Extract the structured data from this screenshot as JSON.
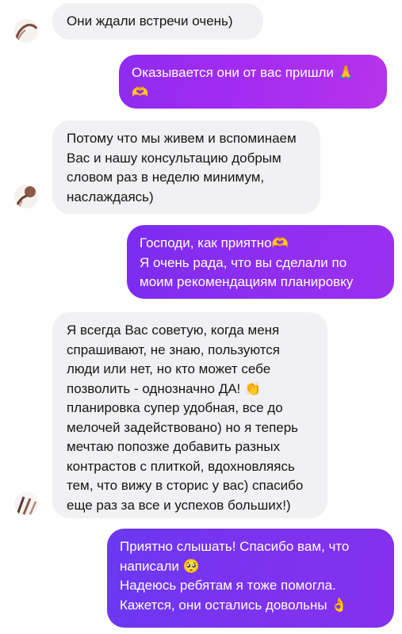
{
  "messages": [
    {
      "direction": "incoming",
      "lines": [
        "Они ждали встречи очень)"
      ]
    },
    {
      "direction": "outgoing",
      "lines": [
        "Оказывается они от вас пришли 🙏",
        "🫶"
      ]
    },
    {
      "direction": "incoming",
      "lines": [
        "Потому что мы живем и вспоминаем",
        "Вас и нашу консультацию добрым",
        "словом раз в неделю минимум,",
        "наслаждаясь)"
      ]
    },
    {
      "direction": "outgoing",
      "lines": [
        "Господи, как приятно🫶",
        "Я очень рада, что вы сделали по",
        "моим рекомендациям планировку"
      ]
    },
    {
      "direction": "incoming",
      "lines": [
        "Я всегда Вас советую, когда меня",
        "спрашивают, не знаю, пользуются",
        "люди или нет, но кто может себе",
        "позволить - однозначно ДА! 👏",
        "планировка супер удобная, все до",
        "мелочей задействовано) но я теперь",
        "мечтаю попозже добавить разных",
        "контрастов с плиткой, вдохновляясь",
        "тем, что вижу в сторис у вас) спасибо",
        "еще раз за все и успехов больших!)"
      ]
    },
    {
      "direction": "outgoing",
      "lines": [
        "Приятно слышать! Спасибо вам, что",
        "написали 🥺",
        "Надеюсь ребятам я тоже помогла.",
        "Кажется, они остались довольны 👌"
      ]
    }
  ],
  "colors": {
    "incoming_bubble": "#f1f1f4",
    "outgoing_gradient_start": "#8f2bf0",
    "outgoing_gradient_end": "#6a38f2",
    "outgoing_text": "#ffffff"
  }
}
